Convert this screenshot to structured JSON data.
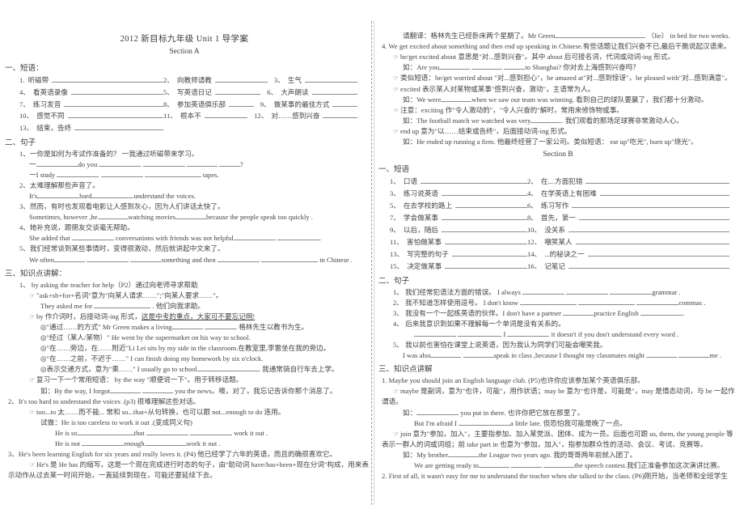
{
  "document": {
    "title": "2012 新目标九年级 Unit 1  导学案",
    "section_a_heading": "Section A",
    "section_b_heading": "Section B"
  },
  "left": {
    "phrases_heading": "一、短语：",
    "phrases": [
      {
        "num": "1.",
        "text": "听磁带"
      },
      {
        "num": "2、",
        "text": "向教师请教"
      },
      {
        "num": "3、",
        "text": "生气"
      },
      {
        "num": "4、",
        "text": "看英语录像"
      },
      {
        "num": "5、",
        "text": "写英语日记"
      },
      {
        "num": "6、",
        "text": "大声朗读"
      },
      {
        "num": "7、",
        "text": "练习发音"
      },
      {
        "num": "8、",
        "text": "参加英语俱乐部"
      },
      {
        "num": "9、",
        "text": "做某事的最佳方式"
      },
      {
        "num": "10、",
        "text": "感觉不同"
      },
      {
        "num": "11、",
        "text": "根本不"
      },
      {
        "num": "12、",
        "text": "对……感到兴奋"
      },
      {
        "num": "13、",
        "text": "结束，告终"
      }
    ],
    "sentences_heading": "二、句子",
    "sentences": [
      {
        "num": "1、",
        "cn": "一你是如何为考试作准备的？      一我通过听磁带来学习。",
        "en_q_pre": "一",
        "en_q_mid": "do you",
        "en_q_end": "?",
        "en_a_pre": "一I study",
        "en_a_end": "tapes."
      },
      {
        "num": "2、",
        "cn": "太难理解那些声音了。",
        "en_pre": "It's",
        "en_mid": "hard",
        "en_end": "understand the voices."
      },
      {
        "num": "3、",
        "cn": "然而，有时也发现看电影让人感到灰心，因为人们讲话太快了。",
        "en_pre": "Sometimes, however ,he",
        "en_mid": "watching movies",
        "en_end": "because the people speak too quickly ."
      },
      {
        "num": "4、",
        "cn": "她补充说，跟朋友交谈毫无帮助。",
        "en_pre": "She added that",
        "en_mid": "conversations with friends was not helpful",
        "en_end": "."
      },
      {
        "num": "5、",
        "cn": "我们经常谈到某些事情时，变得很激动，然后就讲起中文来了。",
        "en_pre": "We often",
        "en_mid": "something and then",
        "en_end": "in Chinese ."
      }
    ],
    "points_heading": "三、知识点讲解：",
    "point1": {
      "title": "1、 by asking the teacher for help（P2）通过向老师寻求帮助",
      "b1": "\"ask+sb+for+名词\"意为\"向某人请求……\";\"向某人要求……\"。",
      "ex1_pre": "They asked me for",
      "ex1_end": ".                他们向我求助。",
      "b2_pre": "by 作介词时，后接动词-ing 形式，",
      "b2_u": "这是中考的重点，大家可不要忘记啊!",
      "s1_pre": "◎\"通过……的方式\"   Mr Green makes a living",
      "s1_end": ".  格林先生以教书为生。",
      "s2": "◎\"经过（某人/某物）\" He went by the supermarket on his way to school.",
      "s3": "◎\"在……旁边，在……附近\"Li Lei sits by my side in the classroom.在教室里,李雷坐在我的旁边。",
      "s4": "◎\"在……之前，不迟于……\" I can finish doing my homework by six o'clock.",
      "s5_pre": "◎表示交通方式，意为\"乘……\" I usually go to school",
      "s5_end": ".  我通常骑自行车去上学。",
      "b3": "复习一下一个常用短语：  by the way \"顺便说一下\"。用于转移话题。",
      "ex2_pre": "如：By the way, I forgot",
      "ex2_end": "you the news。噢，对了，我忘记告诉你那个消息了。"
    },
    "point2": {
      "title": "2、It's too hard to understand the voices .(p3) 很难理解这些对话。",
      "b1": "too...to    太……而不能...      常和 so...that+从句转换，也可以跟 not...enough to do  连用。",
      "try": "试做：He is too careless to work it out .(变成同义句)",
      "a1_pre": "He is so",
      "a1_mid": "that",
      "a1_end": "work it out .",
      "a2_pre": "He is not",
      "a2_mid": "enough",
      "a2_end": "work it out ."
    },
    "point3": {
      "title": "3、He's been learning English for six years and really loves it. (P4)  他已经学了六年的英语，而且的确很喜欢它。",
      "b1": "He's 是 He has 的缩写。这是一个现在完成进行时态的句子，由\"助动词 have/has+been+现在分词\"构成，用来表",
      "b1_cont": "示动作从过去某一时间开始，一直延续到现在，可能还要延续下去。"
    }
  },
  "right": {
    "translate_line_pre": "请翻译：格林先生已经卧床两个星期了。Mr Green",
    "translate_line_end": "（lie）  in bed for two weeks.",
    "point4": {
      "title": "4. We get excited about something and then end up speaking in Chinese.有些话题让我们兴奋不已,最后干脆说起汉语来。",
      "b1": "be/get excited about 意思是\"对...感到兴奋\"。其中 about 后可接名词，代词或动词-ing 形式。",
      "ex1_pre": "如：Are you",
      "ex1_end": "to Shanghai?        你对去上海感到兴奋吗？",
      "b2": "类似短语：be/get worried about \"对...感到担心\"，be amazed at\"对...感到惊讶\"，be pleased with\"对...感到满意\"。",
      "b3": "excited 表示某人对某物或某事\"感到兴奋，激动\"，主语常为人。",
      "ex2_pre": "如：We were",
      "ex2_end": "when we saw our team was winning.   看到自己的球队要赢了，我们都十分激动。",
      "b4": "注意：exciting 作\"令人激动的\"，\"令人兴奋的\"解时，常用来修饰物或事。",
      "ex3_pre": "如：The football match we watched was very",
      "ex3_end": ".      我们观看的那场足球赛非常激动人心。",
      "b5": "end up 意为\"以……结束或告终\"，后面接动词-ing 形式。",
      "ex4": "如：He ended up running a firm. 他最终经营了一家公司。类似短语：    eat up\"吃光\", burn up\"烧光\"。"
    },
    "phrases_heading": "一、短语",
    "phrases": [
      {
        "num": "1、",
        "text": "口语"
      },
      {
        "num": "2、",
        "text": "在....方面犯错"
      },
      {
        "num": "3、",
        "text": "练习说英语"
      },
      {
        "num": "4、",
        "text": "在学英语上有困难"
      },
      {
        "num": "5、",
        "text": "在去学校的路上"
      },
      {
        "num": "6、",
        "text": "练习写作"
      },
      {
        "num": "7、",
        "text": "学会做某事"
      },
      {
        "num": "8、",
        "text": "首先，第一"
      },
      {
        "num": "9、",
        "text": "以后，随后"
      },
      {
        "num": "10、",
        "text": "没关系"
      },
      {
        "num": "11、",
        "text": "害怕做某事"
      },
      {
        "num": "12、",
        "text": "嘲笑某人"
      },
      {
        "num": "13、",
        "text": "写完整的句子"
      },
      {
        "num": "14、",
        "text": "...的秘诀之一"
      },
      {
        "num": "15、",
        "text": "决定做某事"
      },
      {
        "num": "16、",
        "text": "记笔记"
      }
    ],
    "sentences_heading": "二、句子",
    "sentences": [
      {
        "num": "1、",
        "cn": "我们经常犯语法方面的错误。",
        "en_pre": "I always",
        "en_end": "grammar ."
      },
      {
        "num": "2、",
        "cn": "我不知道怎样使用逗号。",
        "en_pre": "I don't know",
        "en_end": "commas ."
      },
      {
        "num": "3、",
        "cn": "我没有一个一起练英语的伙伴。I don't have a partner",
        "en_mid": "practice English",
        "en_end": "."
      },
      {
        "num": "4、",
        "cn": "后来我意识到如果不理解每一个单词是没有关系的。",
        "en_pre": ", I",
        "en_end": "it doesn't if you don't understand every word ."
      },
      {
        "num": "5、",
        "cn": "我以前也害怕在课堂上说英语，因为我认为同学们可能会嘲笑我。",
        "en_pre": "I was also",
        "en_mid": "speak in class ,because I thought my classmates might",
        "en_end": "me ."
      }
    ],
    "points_heading": "三、知识点讲解",
    "point1": {
      "title": "1. Maybe you should join an English language club. (P5)也许你应该参加某个英语俱乐部。",
      "b1": "maybe 是副词，意为\"也许，可能\"，用作状语；may be 意为\"也许是，可能是\"，may 是情态动词，与 be 一起作",
      "b1_cont": "谓语。",
      "ex1_pre": "如：",
      "ex1_end": "you put in there. 也许你把它放在那里了。",
      "ex2_pre": "But I'm afraid I",
      "ex2_end": "a little late. 但恐怕我可能是晚了一点。",
      "b2": "join 意为\"参加，加入\"，主要指参加、加入某党派、团体、成为一员。后面也可跟 us, them, the young people 等",
      "b2_cont": "表示一群人的词或词组；前 take part in 也意为\"参加，加入\"，指参加群众性的活动、会议、考试、竞赛等。",
      "ex3_pre": "如：My brother",
      "ex3_end": "the League two years ago.  我的哥哥两年前就入团了。",
      "ex4_pre": "We are getting ready to",
      "ex4_end": "the speech contest.我们正准备参加这次演讲比赛。"
    },
    "point2": {
      "title": "2. First of all, it wasn't easy for me to understand the teacher when she talked to the class. (P6)刚开始，当老师和全班学生"
    }
  }
}
